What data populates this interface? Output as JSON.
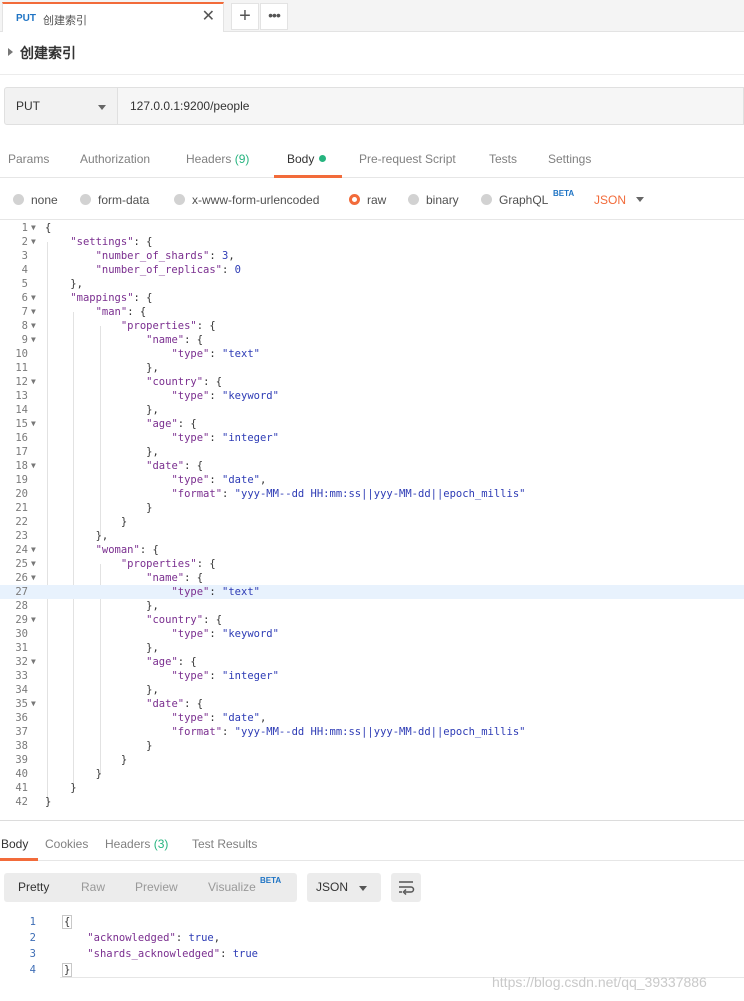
{
  "tab": {
    "method": "PUT",
    "name": "创建索引"
  },
  "request": {
    "title": "创建索引",
    "method": "PUT",
    "url": "127.0.0.1:9200/people"
  },
  "request_tabs": [
    {
      "label": "Params"
    },
    {
      "label": "Authorization"
    },
    {
      "label": "Headers",
      "count": "(9)"
    },
    {
      "label": "Body"
    },
    {
      "label": "Pre-request Script"
    },
    {
      "label": "Tests"
    },
    {
      "label": "Settings"
    }
  ],
  "body_options": {
    "none": "none",
    "form_data": "form-data",
    "urlencoded": "x-www-form-urlencoded",
    "raw": "raw",
    "binary": "binary",
    "graphql": "GraphQL",
    "beta": "BETA",
    "format": "JSON",
    "selected": "raw"
  },
  "editor": {
    "highlighted_line": 27,
    "lines": [
      "{",
      "    \"settings\": {",
      "        \"number_of_shards\": 3,",
      "        \"number_of_replicas\": 0",
      "    },",
      "    \"mappings\": {",
      "        \"man\": {",
      "            \"properties\": {",
      "                \"name\": {",
      "                    \"type\": \"text\"",
      "                },",
      "                \"country\": {",
      "                    \"type\": \"keyword\"",
      "                },",
      "                \"age\": {",
      "                    \"type\": \"integer\"",
      "                },",
      "                \"date\": {",
      "                    \"type\": \"date\",",
      "                    \"format\": \"yyy-MM--dd HH:mm:ss||yyy-MM-dd||epoch_millis\"",
      "                }",
      "            }",
      "        },",
      "        \"woman\": {",
      "            \"properties\": {",
      "                \"name\": {",
      "                    \"type\": \"text\"",
      "                },",
      "                \"country\": {",
      "                    \"type\": \"keyword\"",
      "                },",
      "                \"age\": {",
      "                    \"type\": \"integer\"",
      "                },",
      "                \"date\": {",
      "                    \"type\": \"date\",",
      "                    \"format\": \"yyy-MM--dd HH:mm:ss||yyy-MM-dd||epoch_millis\"",
      "                }",
      "            }",
      "        }",
      "    }",
      "}"
    ],
    "fold_lines": [
      1,
      2,
      6,
      7,
      8,
      9,
      12,
      15,
      18,
      24,
      25,
      26,
      29,
      32,
      35
    ]
  },
  "response_tabs": [
    {
      "label": "Body"
    },
    {
      "label": "Cookies"
    },
    {
      "label": "Headers",
      "count": "(3)"
    },
    {
      "label": "Test Results"
    }
  ],
  "response_view": {
    "pretty": "Pretty",
    "raw": "Raw",
    "preview": "Preview",
    "visualize": "Visualize",
    "beta": "BETA",
    "format": "JSON"
  },
  "response": {
    "lines": [
      "{",
      "    \"acknowledged\": true,",
      "    \"shards_acknowledged\": true",
      "}"
    ]
  },
  "watermark": "https://blog.csdn.net/qq_39337886",
  "colors": {
    "accent": "#f26b3a",
    "green": "#26b47f",
    "method_blue": "#1f74c4"
  }
}
